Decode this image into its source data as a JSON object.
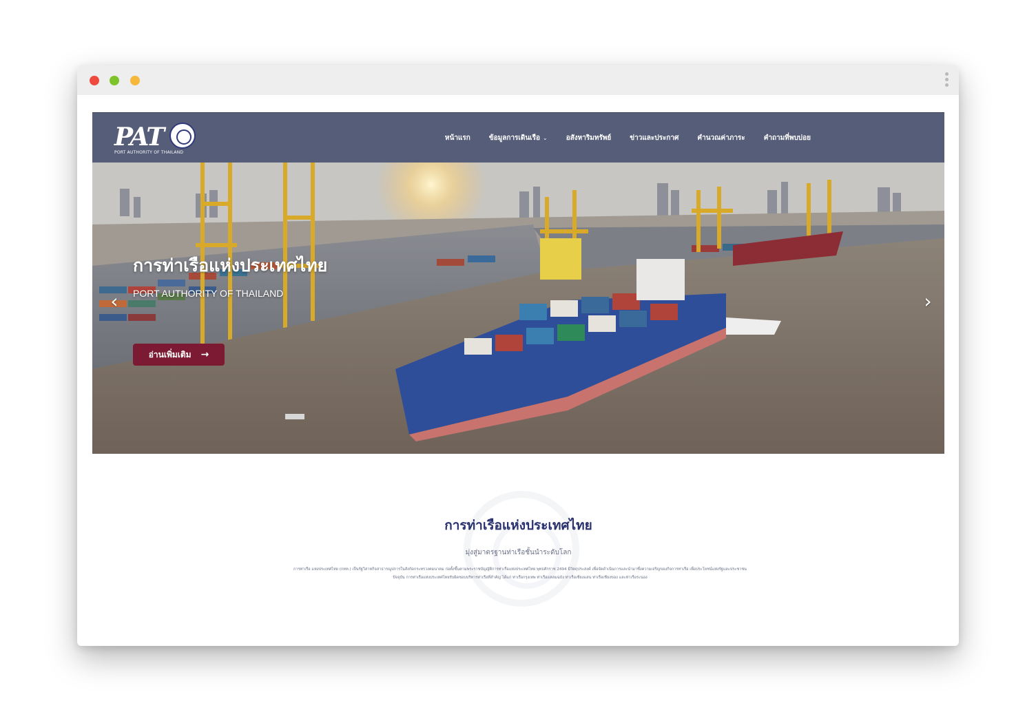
{
  "browser": {
    "dots": [
      "close",
      "minimize",
      "maximize"
    ]
  },
  "header": {
    "logo_text": "PAT",
    "logo_sub": "PORT AUTHORITY OF THAILAND",
    "nav": [
      {
        "label": "หน้าแรก"
      },
      {
        "label": "ข้อมูลการเดินเรือ",
        "dropdown": true
      },
      {
        "label": "อสังหาริมทรัพย์"
      },
      {
        "label": "ข่าวและประกาศ"
      },
      {
        "label": "คำนวณค่าภาระ"
      },
      {
        "label": "คำถามที่พบบ่อย"
      }
    ],
    "colors": {
      "bar": "#565d78"
    }
  },
  "hero": {
    "title": "การท่าเรือแห่งประเทศไทย",
    "subtitle": "PORT AUTHORITY OF THAILAND",
    "button_label": "อ่านเพิ่มเติม",
    "button_icon": "arrow-right-icon",
    "prev_icon": "chevron-left-icon",
    "next_icon": "chevron-right-icon",
    "colors": {
      "button": "#7c1a33"
    }
  },
  "intro": {
    "title": "การท่าเรือแห่งประเทศไทย",
    "subtitle": "มุ่งสู่มาตรฐานท่าเรือชั้นนำระดับโลก",
    "body": "การท่าเรือ แห่งประเทศไทย (กทท.) เป็นรัฐวิสาหกิจสาธารณูปการในสังกัดกระทรวงคมนาคม ก่อตั้งขึ้นตามพระราชบัญญัติการท่าเรือแห่งประเทศไทย พุทธศักราช 2494 มีวัตถุประสงค์ เพื่อจัดดำเนินการและนำมาซึ่งความเจริญของกิจการท่าเรือ เพื่อประโยชน์แห่งรัฐและประชาชน ปัจจุบัน การท่าเรือแห่งประเทศไทยรับผิดชอบบริหารท่าเรือที่สำคัญ ได้แก่ ท่าเรือกรุงเทพ ท่าเรือแหลมฉบัง ท่าเรือเชียงแสน ท่าเรือเชียงของ และท่าเรือระนอง",
    "colors": {
      "title": "#28306e",
      "text": "#6a6f86"
    }
  }
}
